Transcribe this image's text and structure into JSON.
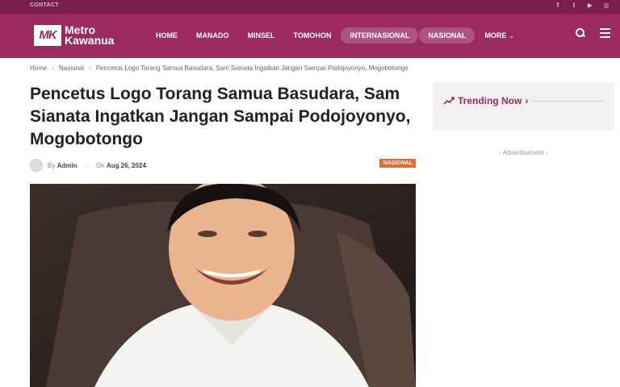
{
  "topbar": {
    "contact": "CONTACT",
    "social": [
      "facebook-icon",
      "twitter-icon",
      "youtube-icon",
      "instagram-icon"
    ]
  },
  "brand": {
    "mark": "MK",
    "line1": "Metro",
    "line2": "Kawanua",
    "color": "#9b2a5f"
  },
  "nav": {
    "items": [
      {
        "label": "HOME",
        "pill": false
      },
      {
        "label": "MANADO",
        "pill": false
      },
      {
        "label": "MINSEL",
        "pill": false
      },
      {
        "label": "TOMOHON",
        "pill": false
      },
      {
        "label": "INTERNASIONAL",
        "pill": true
      },
      {
        "label": "NASIONAL",
        "pill": true
      },
      {
        "label": "MORE",
        "pill": false
      }
    ]
  },
  "breadcrumb": {
    "home": "Home",
    "category": "Nasional",
    "current": "Pencetus Logo Torang Samua Basudara, Sam Sianata Ingatkan Jangan Sampai Podojoyonyo, Mogobotongo"
  },
  "article": {
    "title": "Pencetus Logo Torang Samua Basudara, Sam Sianata Ingatkan Jangan Sampai Podojoyonyo, Mogobotongo",
    "by": "By",
    "author": "Admin",
    "on": "On",
    "date": "Aug 26, 2024",
    "category_badge": "NASIONAL",
    "badge_color": "#e46b2d"
  },
  "sidebar": {
    "trending": "Trending Now",
    "advertisement": "- Advertisement -"
  }
}
